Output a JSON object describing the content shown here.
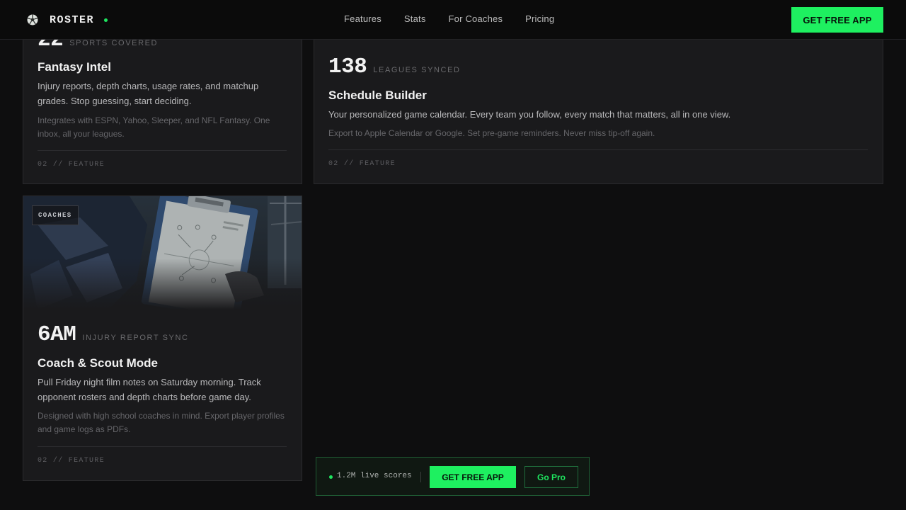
{
  "nav": {
    "brand": "ROSTER",
    "brand_icon": "soccer-ball-icon",
    "links": [
      "Features",
      "Stats",
      "For Coaches",
      "Pricing"
    ],
    "cta": "GET FREE APP"
  },
  "cards": {
    "fantasy": {
      "stat": "22",
      "stat_label": "SPORTS COVERED",
      "title": "Fantasy Intel",
      "desc": "Injury reports, depth charts, usage rates, and matchup grades. Stop guessing, start deciding.",
      "note": "Integrates with ESPN, Yahoo, Sleeper, and NFL Fantasy. One inbox, all your leagues.",
      "footer": "02 // FEATURE"
    },
    "schedule": {
      "stat": "138",
      "stat_label": "LEAGUES SYNCED",
      "title": "Schedule Builder",
      "desc": "Your personalized game calendar. Every team you follow, every match that matters, all in one view.",
      "note": "Export to Apple Calendar or Google. Set pre-game reminders. Never miss tip-off again.",
      "footer": "02 // FEATURE"
    },
    "coach": {
      "badge": "COACHES",
      "stat": "6AM",
      "stat_label": "INJURY REPORT SYNC",
      "title": "Coach & Scout Mode",
      "desc": "Pull Friday night film notes on Saturday morning. Track opponent rosters and depth charts before game day.",
      "note": "Designed with high school coaches in mind. Export player profiles and game logs as PDFs.",
      "footer": "02 // FEATURE"
    }
  },
  "floatbar": {
    "live": "1.2M live scores",
    "cta": "GET FREE APP",
    "pro": "Go Pro"
  },
  "colors": {
    "accent": "#1ef060",
    "background": "#0e0e0f",
    "card": "#1a1a1c"
  }
}
